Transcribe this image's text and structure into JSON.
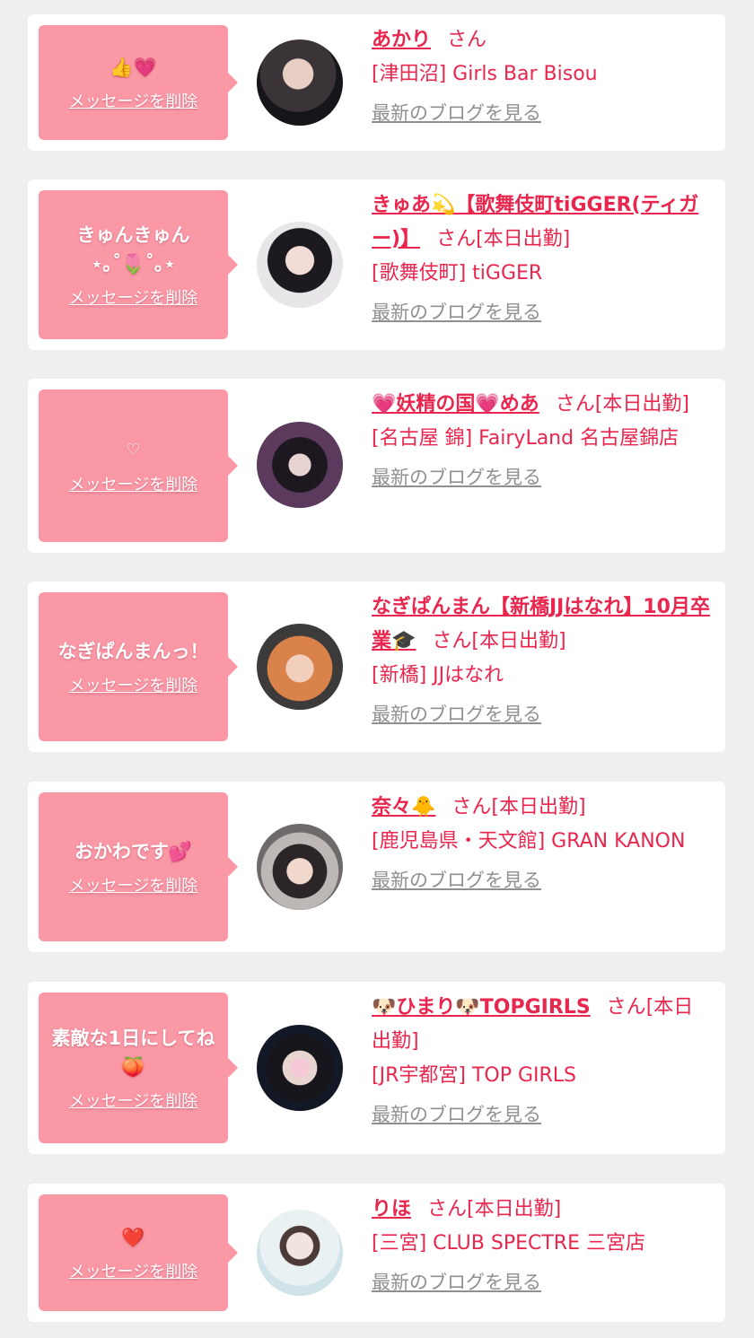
{
  "suffix_san": "さん",
  "delete_label": "メッセージを削除",
  "blog_label": "最新のブログを見る",
  "colors": {
    "accent": "#e8264e",
    "bubble": "#fb98a6",
    "background": "#efefef",
    "link_gray": "#909090"
  },
  "items": [
    {
      "message": "👍💗",
      "name": "あかり",
      "status": "",
      "shop": "[津田沼] Girls Bar Bisou"
    },
    {
      "message": "きゅんきゅん\n⋆｡˚🌷˚｡⋆",
      "name": "きゅあ💫【歌舞伎町tiGGER(ティガー)】",
      "status": "[本日出勤]",
      "shop": "[歌舞伎町] tiGGER"
    },
    {
      "message": "♡",
      "name": "💗妖精の国💗めあ",
      "status": "[本日出勤]",
      "shop": "[名古屋 錦] FairyLand 名古屋錦店"
    },
    {
      "message": "なぎぱんまんっ！",
      "name": "なぎぱんまん【新橋JJはなれ】10月卒業🎓",
      "status": "[本日出勤]",
      "shop": "[新橋] JJはなれ"
    },
    {
      "message": "おかわです💕",
      "name": "奈々🐥",
      "status": "[本日出勤]",
      "shop": "[鹿児島県・天文館] GRAN KANON"
    },
    {
      "message": "素敵な1日にしてね🍑",
      "name": "🐶ひまり🐶TOPGIRLS",
      "status": "[本日出勤]",
      "shop": "[JR宇都宮] TOP GIRLS"
    },
    {
      "message": "❤️",
      "name": "りほ",
      "status": "[本日出勤]",
      "shop": "[三宮] CLUB SPECTRE 三宮店"
    }
  ]
}
